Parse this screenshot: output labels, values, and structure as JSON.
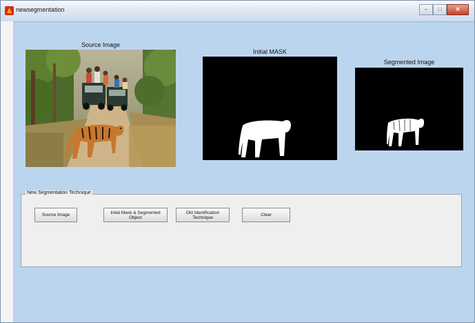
{
  "window": {
    "title": "newsegmentation",
    "controls": [
      "minimize-icon",
      "maximize-icon",
      "close-icon"
    ]
  },
  "images": {
    "source": {
      "title": "Source Image"
    },
    "mask": {
      "title": "Initial MASK"
    },
    "segmented": {
      "title": "Segmented Image"
    }
  },
  "panel": {
    "legend": "New Segmentation Technique",
    "buttons": {
      "source": "Source Image",
      "mask_segmented": "Inital Mask & Segmented Object",
      "old_identification": "Old Identification Technique",
      "clear": "Clear"
    }
  },
  "colors": {
    "figure_background": "#bcd5ef",
    "panel_background": "#efefef",
    "mask_background": "#000000",
    "mask_foreground": "#ffffff"
  }
}
